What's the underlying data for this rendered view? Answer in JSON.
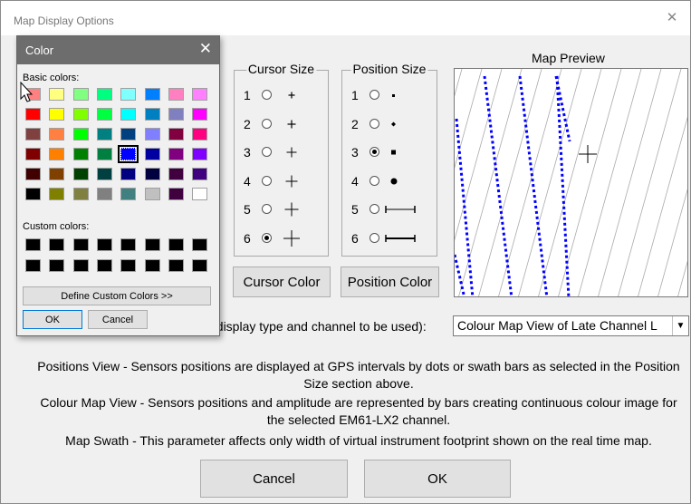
{
  "window": {
    "title": "Map Display Options",
    "close_glyph": "✕"
  },
  "cursor_size": {
    "title": "Cursor Size",
    "options": [
      {
        "num": "1",
        "checked": false
      },
      {
        "num": "2",
        "checked": false
      },
      {
        "num": "3",
        "checked": false
      },
      {
        "num": "4",
        "checked": false
      },
      {
        "num": "5",
        "checked": false
      },
      {
        "num": "6",
        "checked": true
      }
    ]
  },
  "position_size": {
    "title": "Position Size",
    "options": [
      {
        "num": "1",
        "checked": false
      },
      {
        "num": "2",
        "checked": false
      },
      {
        "num": "3",
        "checked": true
      },
      {
        "num": "4",
        "checked": false
      },
      {
        "num": "5",
        "checked": false
      },
      {
        "num": "6",
        "checked": false
      }
    ]
  },
  "buttons": {
    "cursor_color": "Cursor Color",
    "position_color": "Position Color",
    "cancel": "Cancel",
    "ok": "OK"
  },
  "preview": {
    "label": "Map Preview"
  },
  "display_mode": {
    "label": "t display type and channel to be used):",
    "selected": "Colour Map View of Late Channel L"
  },
  "description": [
    "Positions View - Sensors positions are displayed at GPS intervals by dots or swath bars as selected in the Position Size section above.",
    "Colour Map View - Sensors positions and amplitude are represented by bars creating continuous colour image for the selected EM61-LX2 channel.",
    "Map Swath - This parameter affects only width of virtual instrument footprint shown on the real time map."
  ],
  "color_dialog": {
    "title": "Color",
    "close_glyph": "✕",
    "basic_colors_label": "Basic colors:",
    "custom_colors_label": "Custom colors:",
    "define_custom_label": "Define Custom Colors >>",
    "ok_label": "OK",
    "cancel_label": "Cancel",
    "selected_color": "#0000ff",
    "basic_colors": [
      [
        "#ff8080",
        "#ffff80",
        "#80ff80",
        "#00ff80",
        "#80ffff",
        "#0080ff",
        "#ff80c0",
        "#ff80ff"
      ],
      [
        "#ff0000",
        "#ffff00",
        "#80ff00",
        "#00ff40",
        "#00ffff",
        "#0080c0",
        "#8080c0",
        "#ff00ff"
      ],
      [
        "#804040",
        "#ff8040",
        "#00ff00",
        "#008080",
        "#004080",
        "#8080ff",
        "#800040",
        "#ff0080"
      ],
      [
        "#800000",
        "#ff8000",
        "#008000",
        "#008040",
        "#0000ff",
        "#0000a0",
        "#800080",
        "#8000ff"
      ],
      [
        "#400000",
        "#804000",
        "#004000",
        "#004040",
        "#000080",
        "#000040",
        "#400040",
        "#400080"
      ],
      [
        "#000000",
        "#808000",
        "#808040",
        "#808080",
        "#408080",
        "#c0c0c0",
        "#400040",
        "#ffffff"
      ]
    ],
    "custom_colors": [
      [
        "#000000",
        "#000000",
        "#000000",
        "#000000",
        "#000000",
        "#000000",
        "#000000",
        "#000000"
      ],
      [
        "#000000",
        "#000000",
        "#000000",
        "#000000",
        "#000000",
        "#000000",
        "#000000",
        "#000000"
      ]
    ]
  }
}
